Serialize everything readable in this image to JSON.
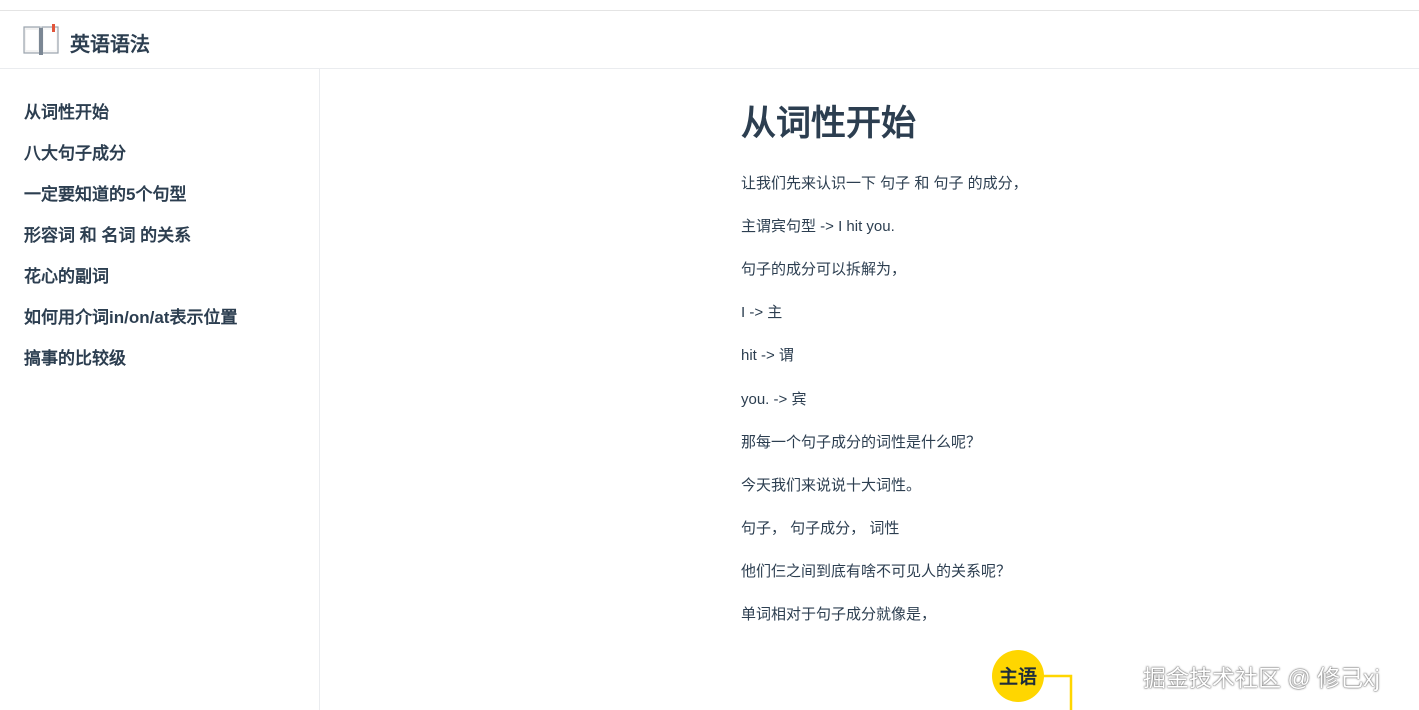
{
  "navbar": {
    "title": "英语语法",
    "logo_icon": "open-book-icon"
  },
  "sidebar": {
    "items": [
      {
        "label": "从词性开始"
      },
      {
        "label": "八大句子成分"
      },
      {
        "label": "一定要知道的5个句型"
      },
      {
        "label": "形容词 和 名词 的关系"
      },
      {
        "label": "花心的副词"
      },
      {
        "label": "如何用介词in/on/at表示位置"
      },
      {
        "label": "搞事的比较级"
      }
    ]
  },
  "content": {
    "title": "从词性开始",
    "paragraphs": [
      "让我们先来认识一下 句子 和 句子 的成分，",
      "主谓宾句型 -> I hit you.",
      "句子的成分可以拆解为，",
      "I -> 主",
      "hit -> 谓",
      "you. -> 宾",
      "那每一个句子成分的词性是什么呢？",
      "今天我们来说说十大词性。",
      "句子， 句子成分， 词性",
      "他们仨之间到底有啥不可见人的关系呢？",
      "单词相对于句子成分就像是，"
    ],
    "figure_label": "主语",
    "figure_color": "#ffd600"
  },
  "watermark": "掘金技术社区 @ 修己xj"
}
